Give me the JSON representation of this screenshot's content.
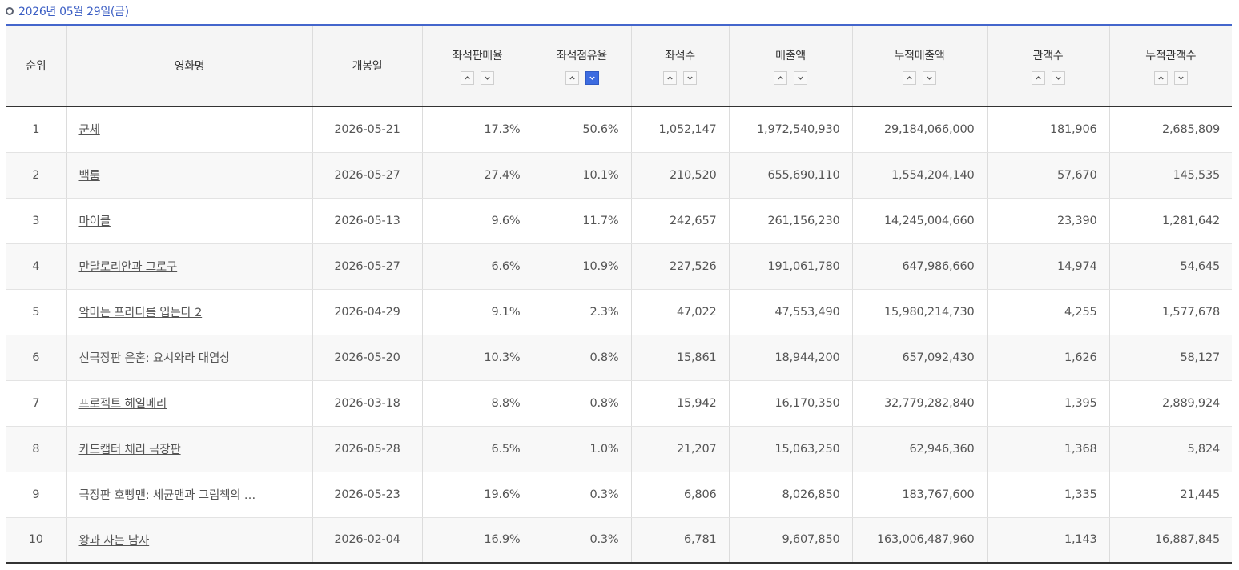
{
  "date_label": "2026년 05월 29일(금)",
  "headers": [
    "순위",
    "영화명",
    "개봉일",
    "좌석판매율",
    "좌석점유율",
    "좌석수",
    "매출액",
    "누적매출액",
    "관객수",
    "누적관객수"
  ],
  "sort_active": "좌석점유율",
  "rows": [
    {
      "rank": "1",
      "title": "군체",
      "open": "2026-05-21",
      "sell_rate": "17.3%",
      "share": "50.6%",
      "seats": "1,052,147",
      "sales": "1,972,540,930",
      "cum_sales": "29,184,066,000",
      "audience": "181,906",
      "cum_audience": "2,685,809"
    },
    {
      "rank": "2",
      "title": "백룸",
      "open": "2026-05-27",
      "sell_rate": "27.4%",
      "share": "10.1%",
      "seats": "210,520",
      "sales": "655,690,110",
      "cum_sales": "1,554,204,140",
      "audience": "57,670",
      "cum_audience": "145,535"
    },
    {
      "rank": "3",
      "title": "마이클",
      "open": "2026-05-13",
      "sell_rate": "9.6%",
      "share": "11.7%",
      "seats": "242,657",
      "sales": "261,156,230",
      "cum_sales": "14,245,004,660",
      "audience": "23,390",
      "cum_audience": "1,281,642"
    },
    {
      "rank": "4",
      "title": "만달로리안과 그로구",
      "open": "2026-05-27",
      "sell_rate": "6.6%",
      "share": "10.9%",
      "seats": "227,526",
      "sales": "191,061,780",
      "cum_sales": "647,986,660",
      "audience": "14,974",
      "cum_audience": "54,645"
    },
    {
      "rank": "5",
      "title": "악마는 프라다를 입는다 2",
      "open": "2026-04-29",
      "sell_rate": "9.1%",
      "share": "2.3%",
      "seats": "47,022",
      "sales": "47,553,490",
      "cum_sales": "15,980,214,730",
      "audience": "4,255",
      "cum_audience": "1,577,678"
    },
    {
      "rank": "6",
      "title": "신극장판 은혼: 요시와라 대염상",
      "open": "2026-05-20",
      "sell_rate": "10.3%",
      "share": "0.8%",
      "seats": "15,861",
      "sales": "18,944,200",
      "cum_sales": "657,092,430",
      "audience": "1,626",
      "cum_audience": "58,127"
    },
    {
      "rank": "7",
      "title": "프로젝트 헤일메리",
      "open": "2026-03-18",
      "sell_rate": "8.8%",
      "share": "0.8%",
      "seats": "15,942",
      "sales": "16,170,350",
      "cum_sales": "32,779,282,840",
      "audience": "1,395",
      "cum_audience": "2,889,924"
    },
    {
      "rank": "8",
      "title": "카드캡터 체리 극장판",
      "open": "2026-05-28",
      "sell_rate": "6.5%",
      "share": "1.0%",
      "seats": "21,207",
      "sales": "15,063,250",
      "cum_sales": "62,946,360",
      "audience": "1,368",
      "cum_audience": "5,824"
    },
    {
      "rank": "9",
      "title": "극장판 호빵맨: 세균맨과 그림책의 …",
      "open": "2026-05-23",
      "sell_rate": "19.6%",
      "share": "0.3%",
      "seats": "6,806",
      "sales": "8,026,850",
      "cum_sales": "183,767,600",
      "audience": "1,335",
      "cum_audience": "21,445"
    },
    {
      "rank": "10",
      "title": "왕과 사는 남자",
      "open": "2026-02-04",
      "sell_rate": "16.9%",
      "share": "0.3%",
      "seats": "6,781",
      "sales": "9,607,850",
      "cum_sales": "163,006,487,960",
      "audience": "1,143",
      "cum_audience": "16,887,845"
    }
  ],
  "colors": {
    "accent": "#4466cc",
    "date_text": "#3b5ec4",
    "active_sort": "#3c6be0"
  },
  "icons": {
    "sort_up": "chevron-up-icon",
    "sort_down": "chevron-down-icon",
    "date_bullet": "circle-icon"
  }
}
